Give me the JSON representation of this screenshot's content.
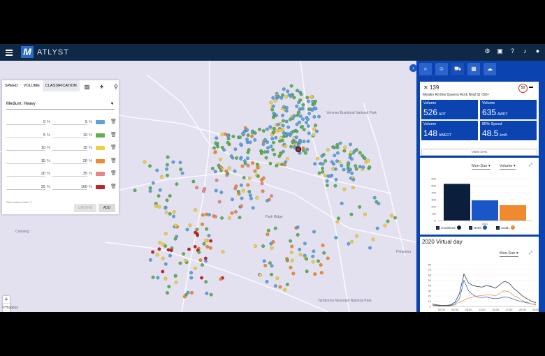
{
  "app": {
    "brand": "ATLYST",
    "logo_letter": "M"
  },
  "topbar_icons": [
    "gear-icon",
    "chat-icon",
    "help-icon",
    "bell-icon",
    "user-icon"
  ],
  "map": {
    "labels": [
      "Venman Bushland National Park",
      "Park Ridge",
      "Pimpama",
      "Crossing",
      "Tamborine Mountain National Park",
      "Mapbox"
    ],
    "zoom": {
      "plus": "+",
      "minus": "−",
      "compass": "▲"
    },
    "attribution": "© mapbox",
    "colors": {
      "blue": "#5aa3df",
      "green": "#5fb04f",
      "yellow": "#f2cf3a",
      "orange": "#f08a2e",
      "pink": "#e88587",
      "red": "#c0242c"
    }
  },
  "classification_panel": {
    "tabs": [
      "SPEED",
      "VOLUME",
      "CLASSIFICATION"
    ],
    "active_tab": "CLASSIFICATION",
    "preset": "Medium, Heavy",
    "rows": [
      {
        "from": "0",
        "to": "5",
        "color": "#5aa3df"
      },
      {
        "from": "5",
        "to": "10",
        "color": "#5fb04f"
      },
      {
        "from": "10",
        "to": "15",
        "color": "#f2cf3a"
      },
      {
        "from": "15",
        "to": "20",
        "color": "#f08a2e"
      },
      {
        "from": "20",
        "to": "25",
        "color": "#e88587"
      },
      {
        "from": "25",
        "to": "100",
        "color": "#c0242c"
      }
    ],
    "percent": "%",
    "no_data": "Sites without data: 3",
    "update_label": "UPDATE",
    "add_label": "ADD"
  },
  "site": {
    "id": "139",
    "name": "Meakin Rd btw Queens Rd & Beal St <50>",
    "speed_limit": "50",
    "stats": [
      {
        "label": "Volume",
        "value": "526",
        "unit": "ADT"
      },
      {
        "label": "Volume",
        "value": "635",
        "unit": "AWDT"
      },
      {
        "label": "Volume",
        "value": "148",
        "unit": "AWEDT"
      },
      {
        "label": "85% Speed",
        "value": "48.5",
        "unit": "km/h"
      }
    ],
    "view_site": "VIEW SITE"
  },
  "bar_chart": {
    "filter1": "Mon-Sun",
    "filter2": "Volume",
    "legend": [
      "Combined",
      "North",
      "South"
    ]
  },
  "virtual_day": {
    "title": "2020 Virtual day",
    "filter": "Mon-Sun"
  },
  "chart_data": [
    {
      "type": "bar",
      "categories": [
        "2020"
      ],
      "series": [
        {
          "name": "Combined",
          "values": [
            526
          ],
          "color": "#0b1f3c"
        },
        {
          "name": "North",
          "values": [
            290
          ],
          "color": "#1a56c5"
        },
        {
          "name": "South",
          "values": [
            220
          ],
          "color": "#f08a2e"
        }
      ],
      "ylim": [
        0,
        600
      ],
      "yticks": [
        "0",
        "100",
        "200",
        "300",
        "400",
        "500",
        "600"
      ]
    },
    {
      "type": "line",
      "x": [
        "00:00",
        "01:00",
        "02:00",
        "03:00",
        "04:00",
        "05:00",
        "06:00",
        "07:00",
        "08:00",
        "09:00",
        "10:00",
        "11:00",
        "12:00",
        "13:00",
        "14:00",
        "15:00",
        "16:00",
        "17:00",
        "18:00",
        "19:00",
        "20:00",
        "21:00",
        "22:00",
        "23:00"
      ],
      "xticks": [
        "02:00",
        "05:00",
        "08:00",
        "11:00",
        "14:00",
        "17:00",
        "20:00",
        "23:00"
      ],
      "ylim": [
        0,
        80
      ],
      "yticks": [
        "0",
        "10",
        "20",
        "30",
        "40",
        "50",
        "60",
        "70",
        "80"
      ],
      "series": [
        {
          "name": "Combined",
          "color": "#0b1f3c",
          "values": [
            5,
            3,
            2,
            2,
            3,
            8,
            25,
            62,
            45,
            40,
            38,
            37,
            40,
            38,
            35,
            42,
            48,
            45,
            35,
            28,
            20,
            15,
            10,
            7
          ]
        },
        {
          "name": "North",
          "color": "#1a56c5",
          "values": [
            3,
            2,
            1,
            1,
            2,
            5,
            15,
            50,
            30,
            22,
            18,
            17,
            18,
            16,
            15,
            16,
            18,
            17,
            14,
            11,
            9,
            7,
            5,
            4
          ]
        },
        {
          "name": "South",
          "color": "#f08a2e",
          "values": [
            2,
            1,
            1,
            1,
            1,
            3,
            8,
            12,
            16,
            18,
            20,
            21,
            22,
            22,
            20,
            26,
            30,
            28,
            21,
            17,
            11,
            8,
            5,
            3
          ]
        }
      ]
    }
  ]
}
